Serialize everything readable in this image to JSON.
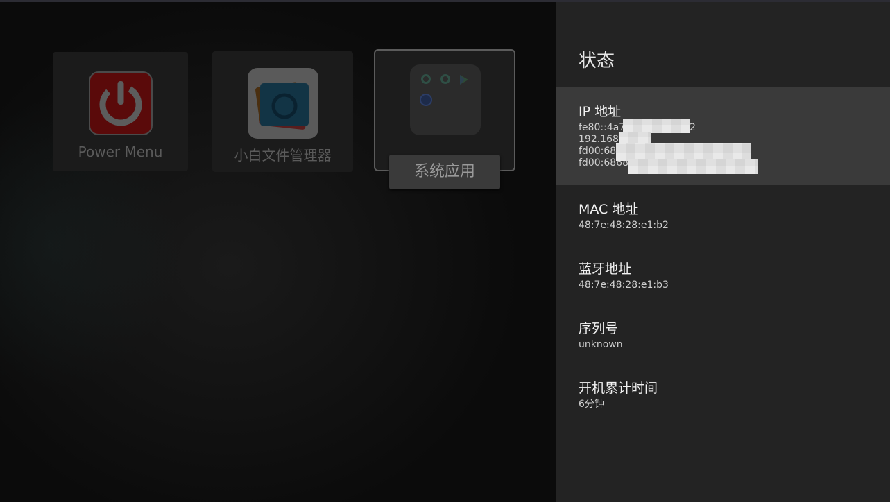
{
  "launcher": {
    "tiles": [
      {
        "label": "Power Menu",
        "icon": "power-icon"
      },
      {
        "label": "小白文件管理器",
        "icon": "folder-camera-icon"
      },
      {
        "label": "系统应用",
        "icon": "app-folder-icon"
      }
    ]
  },
  "status_panel": {
    "title": "状态",
    "items": [
      {
        "title": "IP 地址",
        "values": [
          "fe80::4a7",
          "2",
          "192.168.1",
          "fd00:686",
          "fd00:6868:"
        ]
      },
      {
        "title": "MAC 地址",
        "value": "48:7e:48:28:e1:b2"
      },
      {
        "title": "蓝牙地址",
        "value": "48:7e:48:28:e1:b3"
      },
      {
        "title": "序列号",
        "value": "unknown"
      },
      {
        "title": "开机累计时间",
        "value": "6分钟"
      }
    ]
  },
  "colors": {
    "panel_bg": "#232323",
    "selected_bg": "#3a3a3a",
    "power_red": "#5a0a0a"
  }
}
